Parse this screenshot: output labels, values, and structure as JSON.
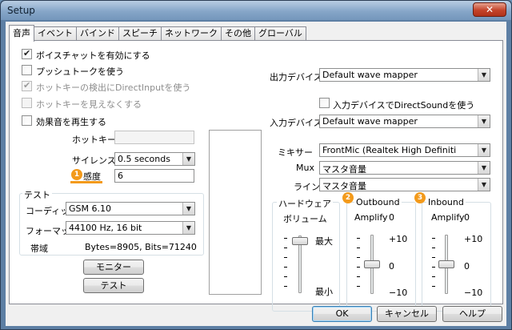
{
  "window": {
    "title": "Setup",
    "close_glyph": "✕"
  },
  "tabs": [
    "音声",
    "イベント",
    "バインド",
    "スピーチ",
    "ネットワーク",
    "その他",
    "グローバル"
  ],
  "left": {
    "enable_voice_chat": "ボイスチャットを有効にする",
    "push_to_talk": "プッシュトークを使う",
    "hotkey_directinput": "ホットキーの検出にDirectInputを使う",
    "hotkey_invisible": "ホットキーを見えなくする",
    "play_effects": "効果音を再生する",
    "hotkey_label": "ホットキー",
    "hotkey_value": "",
    "silence_label": "サイレンス",
    "silence_value": "0.5 seconds",
    "sensitivity_label": "感度",
    "sensitivity_value": "6",
    "test_group_title": "テスト",
    "codec_label": "コーディック",
    "codec_value": "GSM 6.10",
    "format_label": "フォーマット",
    "format_value": "44100 Hz, 16 bit",
    "bandwidth_label": "帯域",
    "bandwidth_value": "Bytes=8905, Bits=71240",
    "monitor_button": "モニター",
    "test_button": "テスト"
  },
  "right": {
    "output_device_label": "出力デバイス",
    "output_device_value": "Default wave mapper",
    "use_directsound": "入力デバイスでDirectSoundを使う",
    "input_device_label": "入力デバイス",
    "input_device_value": "Default wave mapper",
    "mixer_label": "ミキサー",
    "mixer_value": "FrontMic (Realtek High Definiti",
    "mux_label": "Mux",
    "mux_value": "マスタ音量",
    "line_label": "ライン",
    "line_value": "マスタ音量",
    "hardware": {
      "title": "ハードウェア",
      "volume_label": "ボリューム",
      "max_label": "最大",
      "min_label": "最小",
      "level": 0.9
    },
    "outbound": {
      "title": "Outbound",
      "amplify_label": "Amplify",
      "amplify_value": "0",
      "scale": [
        "+10",
        "0",
        "−10"
      ],
      "level": 0.5
    },
    "inbound": {
      "title": "Inbound",
      "amplify_label": "Amplify",
      "amplify_value": "0",
      "scale": [
        "+10",
        "0",
        "−10"
      ],
      "level": 0.5
    }
  },
  "annotations": {
    "badge1": "1",
    "badge2": "2",
    "badge3": "3",
    "accent": "#f39a1b"
  },
  "footer": {
    "ok": "OK",
    "cancel": "キャンセル",
    "help": "ヘルプ"
  }
}
